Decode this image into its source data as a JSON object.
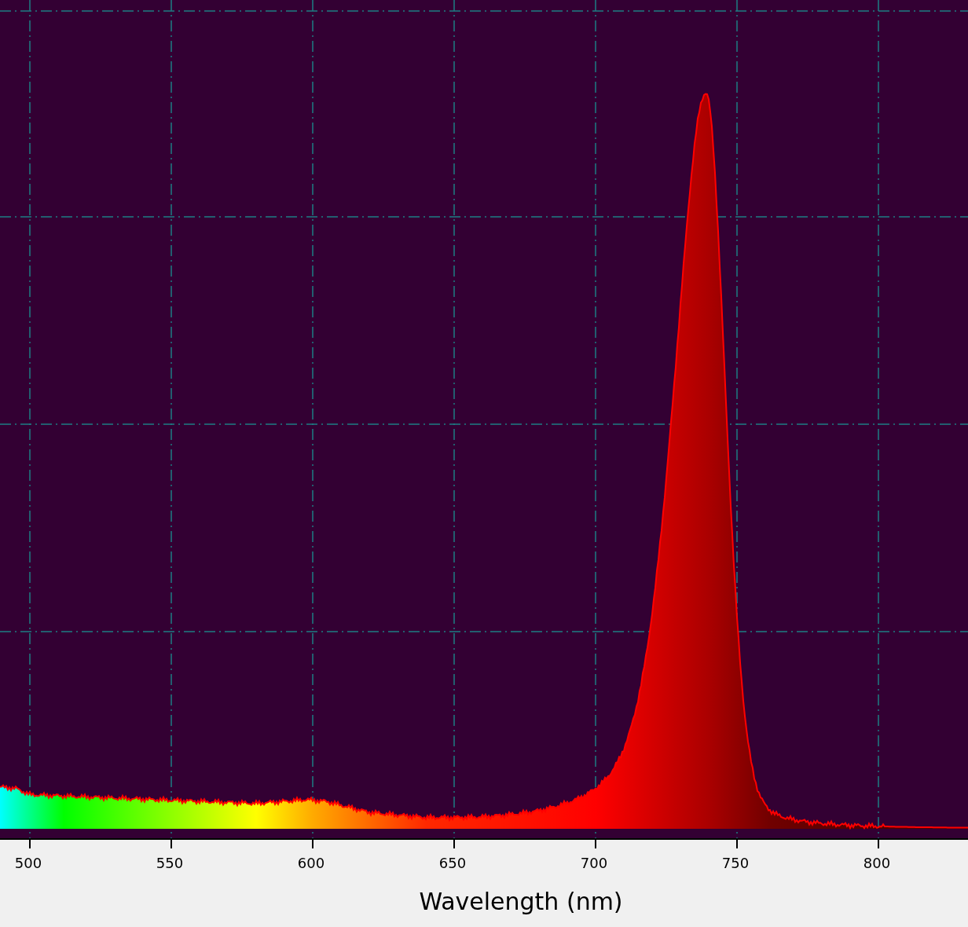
{
  "chart": {
    "x_axis": {
      "ticks": [
        "500",
        "550",
        "600",
        "650",
        "700",
        "750",
        "800"
      ],
      "label": "Wavelength (nm)"
    }
  }
}
